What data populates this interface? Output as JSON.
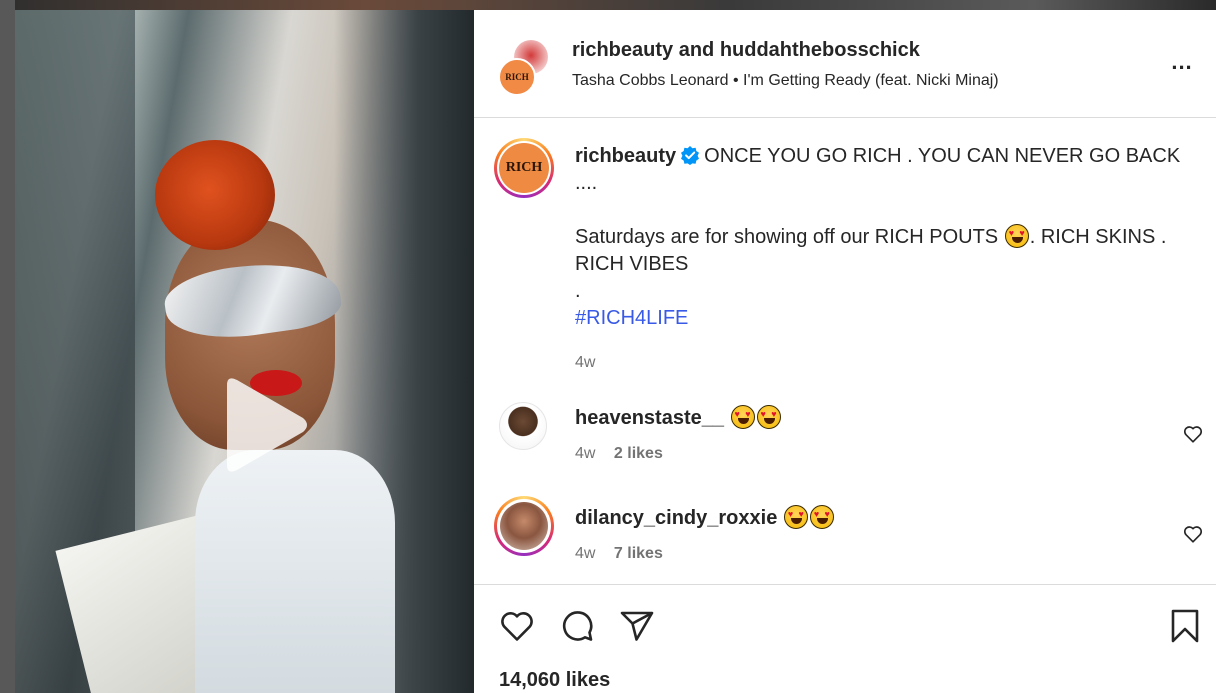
{
  "post": {
    "header": {
      "title": "richbeauty and huddahthebosschick",
      "audio": "Tasha Cobbs Leonard • I'm Getting Ready (feat. Nicki Minaj)",
      "avatar_text": "RICH",
      "more_icon": "more-horizontal-icon",
      "more_label": "..."
    },
    "media": {
      "type": "video",
      "play_icon": "play-icon"
    },
    "caption": {
      "avatar_text": "RICH",
      "username": "richbeauty",
      "verified_icon": "verified-badge-icon",
      "line1": "ONCE YOU GO RICH . YOU CAN NEVER GO BACK",
      "line2": "....",
      "line3a": "Saturdays are for showing off our RICH POUTS",
      "line3b": ". RICH SKINS .",
      "line4": "RICH VIBES",
      "line5": ".",
      "hashtag": "#RICH4LIFE",
      "time": "4w"
    },
    "comments": [
      {
        "username": "heavenstaste__",
        "emoji_count": 2,
        "time": "4w",
        "likes": "2 likes"
      },
      {
        "username": "dilancy_cindy_roxxie",
        "emoji_count": 2,
        "time": "4w",
        "likes": "7 likes"
      }
    ],
    "actions": {
      "like_icon": "heart-outline-icon",
      "comment_icon": "comment-bubble-icon",
      "share_icon": "paper-plane-icon",
      "save_icon": "bookmark-icon",
      "likes_count": "14,060 likes"
    },
    "colors": {
      "hashtag": "#385ae6",
      "verified": "#0095f6",
      "muted_text": "#737373",
      "divider": "#dbdbdb"
    }
  }
}
